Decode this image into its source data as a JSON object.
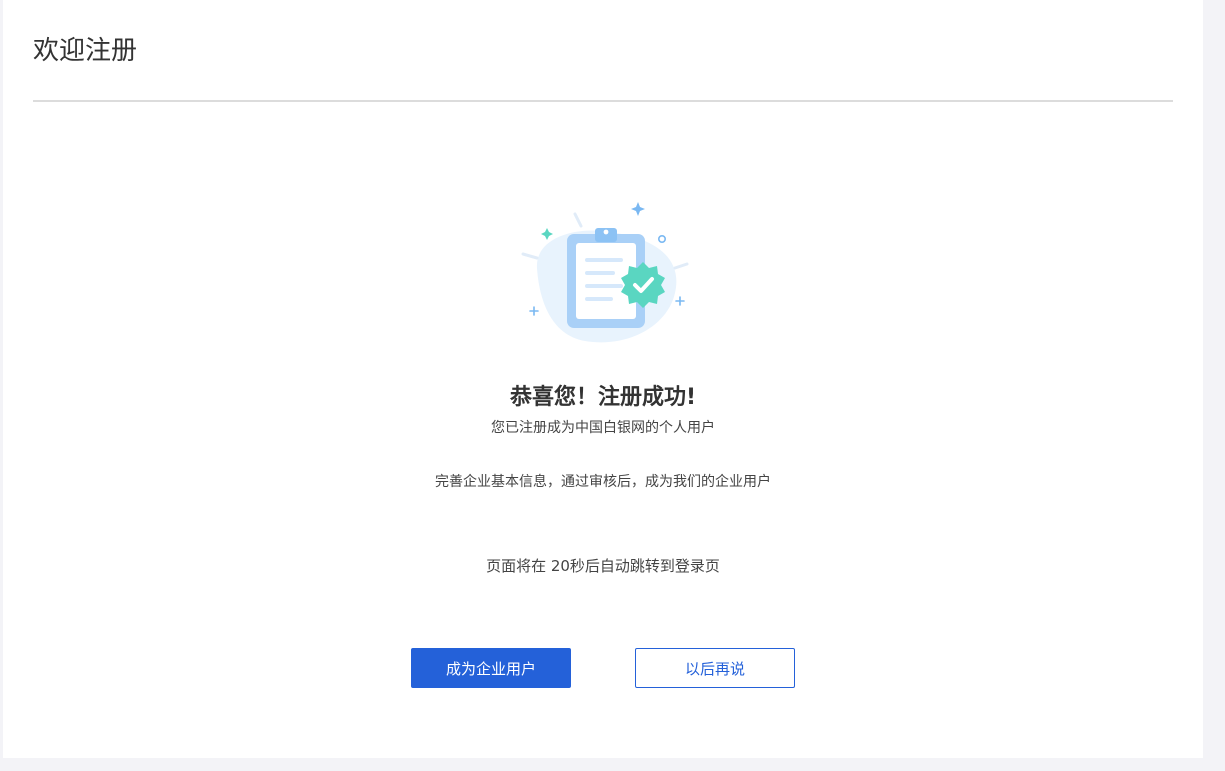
{
  "header": {
    "title": "欢迎注册"
  },
  "illustration": {
    "icon": "clipboard-check-icon",
    "colors": {
      "clipboard": "#a9d0f7",
      "badge": "#5ad6c1",
      "blob": "#e8f3fd"
    }
  },
  "result": {
    "title": "恭喜您！注册成功!",
    "subtitle": "您已注册成为中国白银网的个人用户",
    "hint": "完善企业基本信息，通过审核后，成为我们的企业用户",
    "redirect_text": "页面将在 20秒后自动跳转到登录页"
  },
  "actions": {
    "primary_label": "成为企业用户",
    "secondary_label": "以后再说"
  },
  "colors": {
    "accent": "#2461d9",
    "background": "#f3f3f7"
  }
}
